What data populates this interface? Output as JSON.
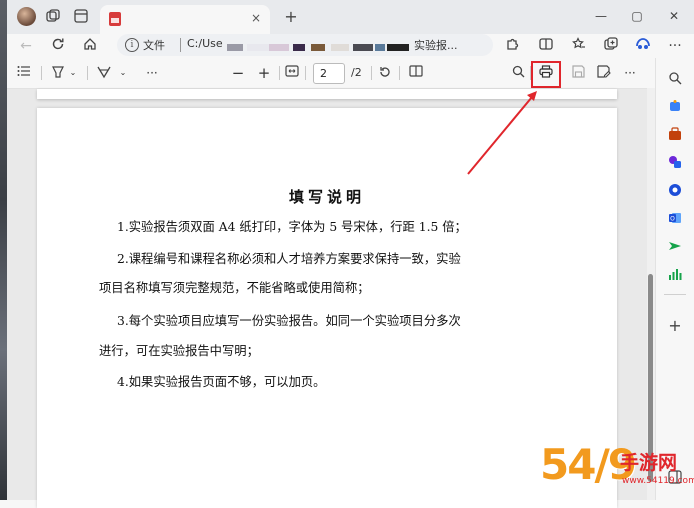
{
  "browser": {
    "tab_title": "",
    "tab_close": "×",
    "new_tab": "+",
    "window_controls": {
      "minimize": "—",
      "maximize": "▢",
      "close": "✕"
    }
  },
  "address_bar": {
    "scheme_label": "文件",
    "path_prefix": "C:/Use",
    "path_suffix": "实验报..."
  },
  "pdf_toolbar": {
    "current_page": "2",
    "total_pages": "/2",
    "zoom_out": "−",
    "zoom_in": "+",
    "more": "···"
  },
  "document": {
    "title": "填写说明",
    "paragraphs": [
      "1.实验报告须双面 A4 纸打印，字体为 5 号宋体，行距 1.5 倍；",
      "2.课程编号和课程名称必须和人才培养方案要求保持一致，实验",
      "项目名称填写须完整规范，不能省略或使用简称；",
      "3.每个实验项目应填写一份实验报告。如同一个实验项目分多次",
      "进行，可在实验报告中写明；",
      "4.如果实验报告页面不够，可以加页。"
    ]
  },
  "sidebar": {
    "add": "+"
  },
  "watermark": {
    "number": "54/9",
    "text": "手游网",
    "url": "www.54119.com"
  },
  "colors": {
    "highlight": "#e0262c",
    "watermark_orange": "#f29a1e"
  },
  "icons": {
    "print": "printer-icon",
    "search": "search-icon",
    "save": "save-icon",
    "save_as": "save-as-icon"
  }
}
